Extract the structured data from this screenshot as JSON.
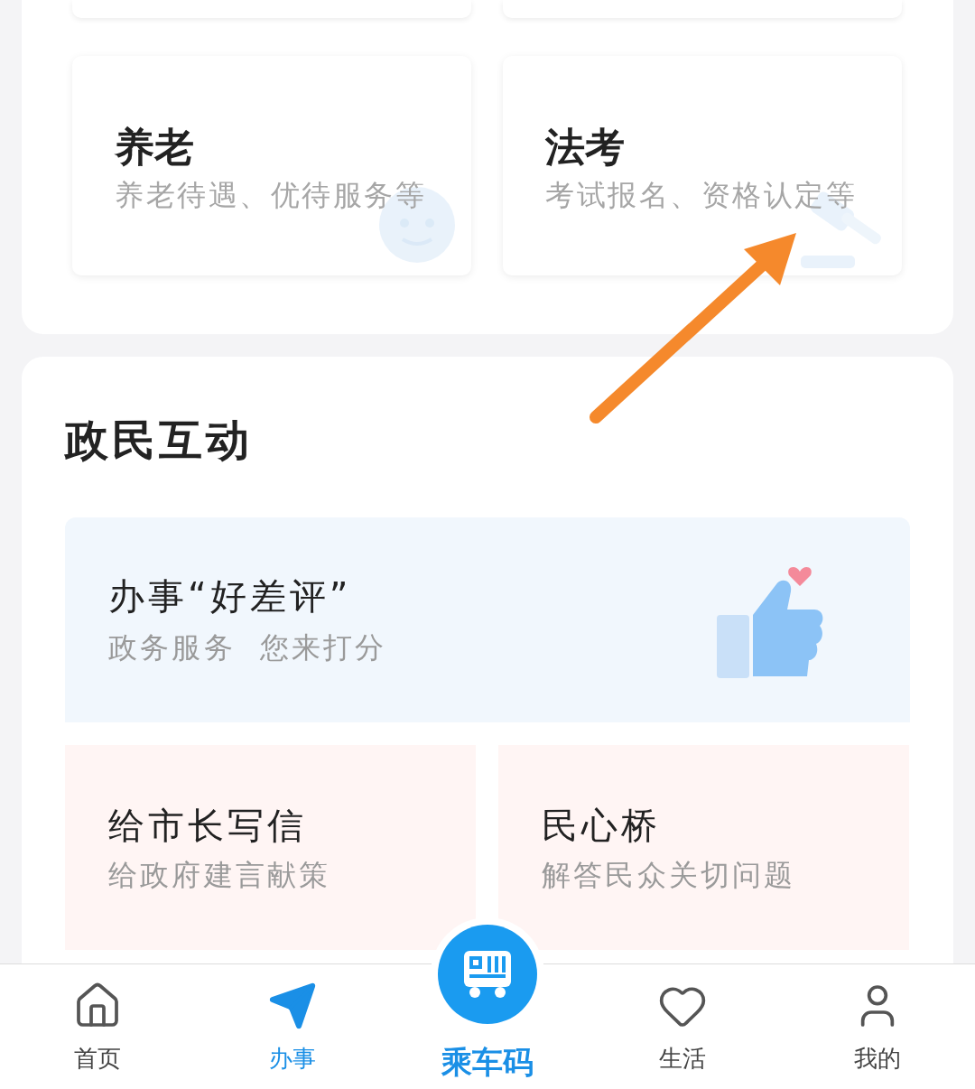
{
  "service_cards": [
    {
      "title": "养老",
      "subtitle": "养老待遇、优待服务等",
      "kind": "face"
    },
    {
      "title": "法考",
      "subtitle": "考试报名、资格认定等",
      "kind": "gavel"
    }
  ],
  "interaction": {
    "heading": "政民互动",
    "feature": {
      "title": "办事“好差评”",
      "subtitle": "政务服务  您来打分"
    },
    "cards": [
      {
        "title": "给市长写信",
        "subtitle": "给政府建言献策"
      },
      {
        "title": "民心桥",
        "subtitle": "解答民众关切问题"
      }
    ]
  },
  "tab_bar": [
    {
      "label": "首页",
      "kind": "home",
      "selected": false
    },
    {
      "label": "办事",
      "kind": "send",
      "selected": true
    },
    {
      "label": "乘车码",
      "kind": "qr",
      "selected": false
    },
    {
      "label": "生活",
      "kind": "heart",
      "selected": false
    },
    {
      "label": "我的",
      "kind": "user",
      "selected": false
    }
  ]
}
